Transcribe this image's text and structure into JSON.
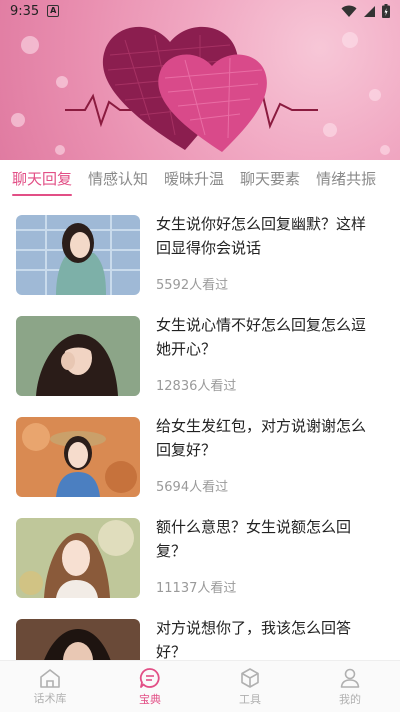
{
  "status_bar": {
    "time": "9:35",
    "notif_glyph": "A"
  },
  "colors": {
    "accent": "#e24f86",
    "muted": "#9a9a9a",
    "inactive_tab": "#8a8a8a"
  },
  "tabs": [
    {
      "label": "聊天回复",
      "active": true
    },
    {
      "label": "情感认知",
      "active": false
    },
    {
      "label": "暧昧升温",
      "active": false
    },
    {
      "label": "聊天要素",
      "active": false
    },
    {
      "label": "情绪共振",
      "active": false
    }
  ],
  "articles": [
    {
      "title": "女生说你好怎么回复幽默？这样回显得你会说话",
      "views": "5592人看过"
    },
    {
      "title": "女生说心情不好怎么回复怎么逗她开心？",
      "views": "12836人看过"
    },
    {
      "title": "给女生发红包，对方说谢谢怎么回复好？",
      "views": "5694人看过"
    },
    {
      "title": "额什么意思？女生说额怎么回复？",
      "views": "11137人看过"
    },
    {
      "title": "对方说想你了，我该怎么回答好？",
      "views": ""
    }
  ],
  "bottom_nav": [
    {
      "label": "话术库",
      "icon": "house-icon",
      "active": false
    },
    {
      "label": "宝典",
      "icon": "chat-bubble-icon",
      "active": true
    },
    {
      "label": "工具",
      "icon": "cube-icon",
      "active": false
    },
    {
      "label": "我的",
      "icon": "person-icon",
      "active": false
    }
  ]
}
